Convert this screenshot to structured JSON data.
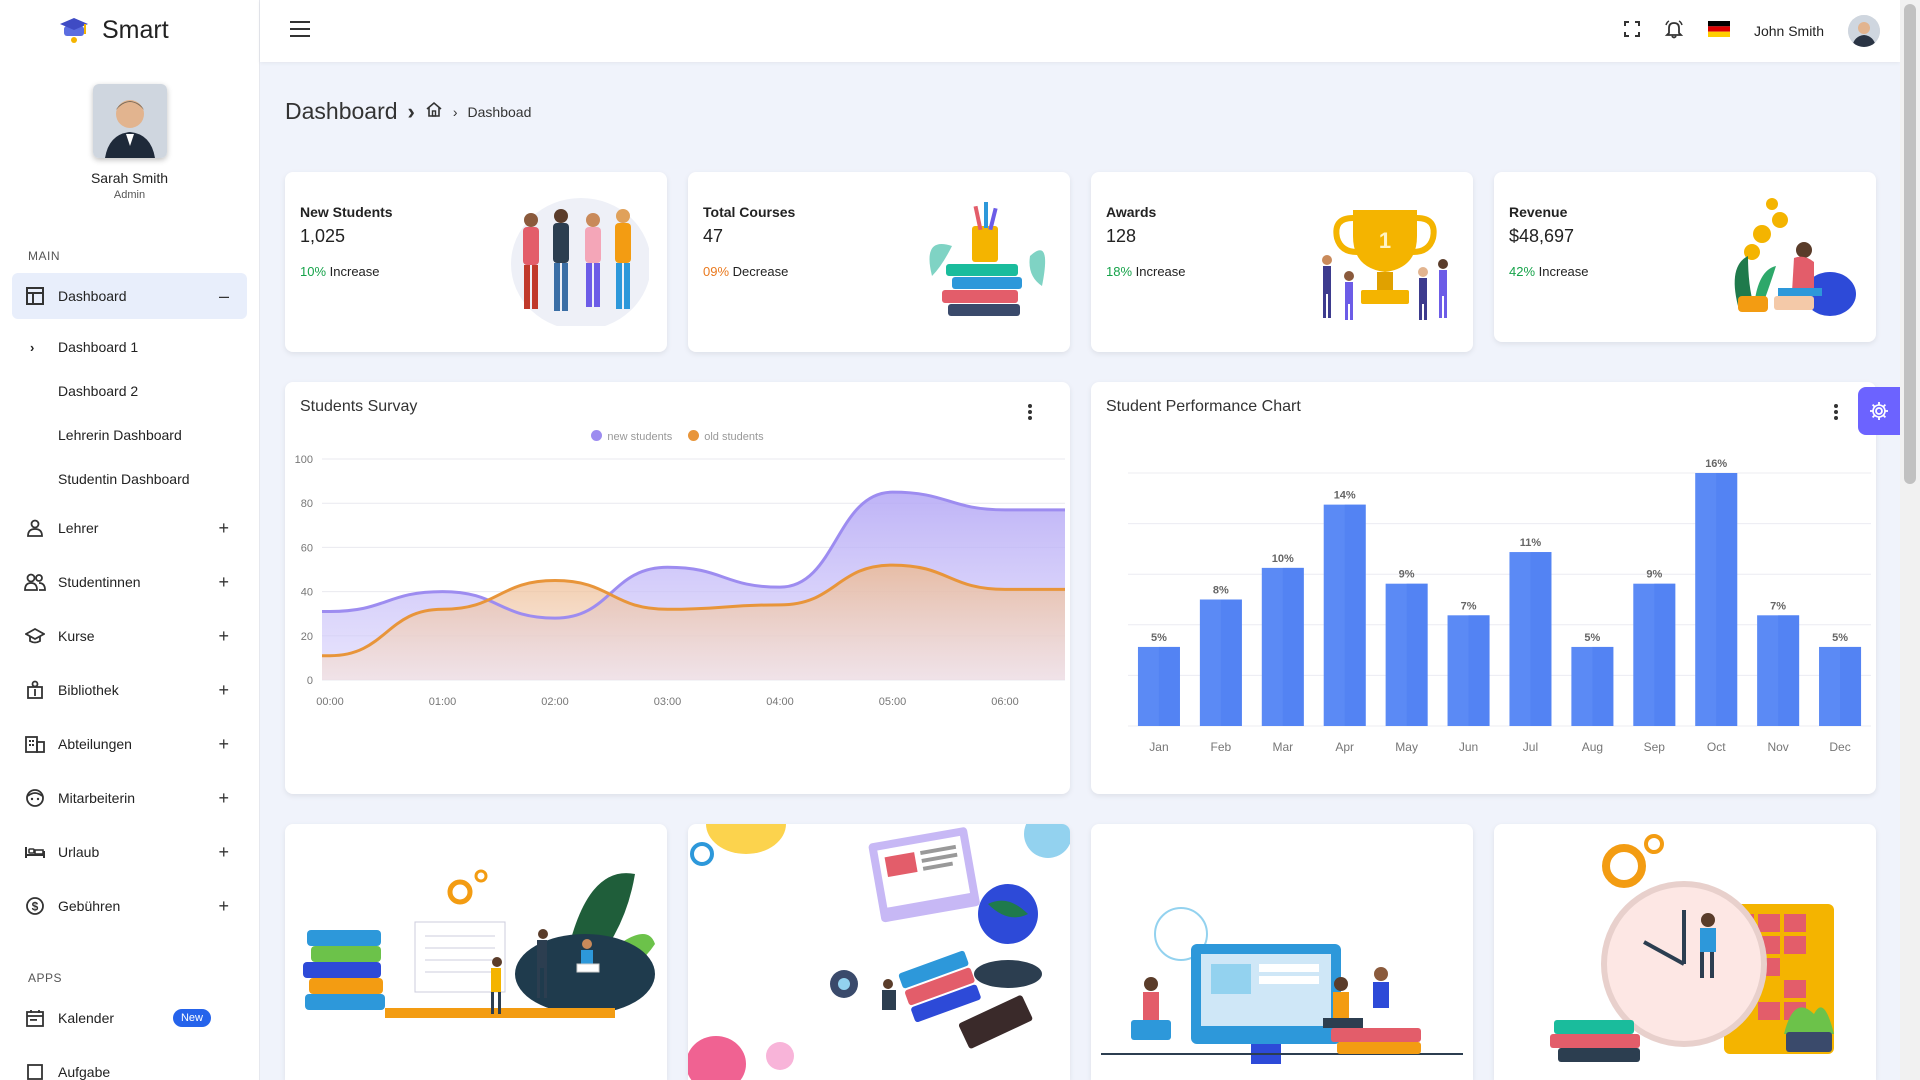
{
  "brand": {
    "name": "Smart"
  },
  "profile": {
    "name": "Sarah Smith",
    "role": "Admin"
  },
  "sidebar": {
    "main_title": "MAIN",
    "dashboard": {
      "label": "Dashboard",
      "toggle": "–"
    },
    "sub_items": [
      "Dashboard 1",
      "Dashboard 2",
      "Lehrerin Dashboard",
      "Studentin Dashboard"
    ],
    "items": [
      {
        "label": "Lehrer",
        "icon": "person-icon",
        "toggle": "+"
      },
      {
        "label": "Studentinnen",
        "icon": "people-icon",
        "toggle": "+"
      },
      {
        "label": "Kurse",
        "icon": "school-cap-icon",
        "toggle": "+"
      },
      {
        "label": "Bibliothek",
        "icon": "library-icon",
        "toggle": "+"
      },
      {
        "label": "Abteilungen",
        "icon": "building-icon",
        "toggle": "+"
      },
      {
        "label": "Mitarbeiterin",
        "icon": "face-icon",
        "toggle": "+"
      },
      {
        "label": "Urlaub",
        "icon": "bed-icon",
        "toggle": "+"
      },
      {
        "label": "Gebühren",
        "icon": "dollar-icon",
        "toggle": "+"
      }
    ],
    "apps_title": "APPS",
    "apps": [
      {
        "label": "Kalender",
        "badge": "New",
        "icon": "calendar-icon"
      },
      {
        "label": "Aufgabe",
        "icon": "task-icon"
      }
    ]
  },
  "header": {
    "user_name": "John Smith"
  },
  "breadcrumb": {
    "title": "Dashboard",
    "sep": "›",
    "current": "Dashboad"
  },
  "stats": [
    {
      "label": "New Students",
      "value": "1,025",
      "pct": "10%",
      "trend": "Increase"
    },
    {
      "label": "Total Courses",
      "value": "47",
      "pct": "09%",
      "trend": "Decrease"
    },
    {
      "label": "Awards",
      "value": "128",
      "pct": "18%",
      "trend": "Increase"
    },
    {
      "label": "Revenue",
      "value": "$48,697",
      "pct": "42%",
      "trend": "Increase"
    }
  ],
  "colors": {
    "accent": "#6c63ff",
    "purple_series": "#9d8cf0",
    "orange_series": "#e8953a",
    "bar": "#5b8af5",
    "bar_dark": "#4f7ef2"
  },
  "survey": {
    "title": "Students Survay",
    "chart_data": {
      "type": "area",
      "x": [
        "00:00",
        "01:00",
        "02:00",
        "03:00",
        "04:00",
        "05:00",
        "06:00"
      ],
      "series": [
        {
          "name": "new students",
          "values": [
            31,
            40,
            28,
            51,
            42,
            85,
            77
          ]
        },
        {
          "name": "old students",
          "values": [
            11,
            32,
            45,
            32,
            34,
            52,
            41
          ]
        }
      ],
      "yticks": [
        0,
        20,
        40,
        60,
        80,
        100
      ],
      "ylim": [
        0,
        100
      ]
    }
  },
  "performance": {
    "title": "Student Performance Chart",
    "chart_data": {
      "type": "bar",
      "categories": [
        "Jan",
        "Feb",
        "Mar",
        "Apr",
        "May",
        "Jun",
        "Jul",
        "Aug",
        "Sep",
        "Oct",
        "Nov",
        "Dec"
      ],
      "values": [
        5,
        8,
        10,
        14,
        9,
        7,
        11,
        5,
        9,
        16,
        7,
        5
      ],
      "labels": [
        "5%",
        "8%",
        "10%",
        "14%",
        "9%",
        "7%",
        "11%",
        "5%",
        "9%",
        "16%",
        "7%",
        "5%"
      ],
      "ylim": [
        0,
        16
      ]
    }
  }
}
